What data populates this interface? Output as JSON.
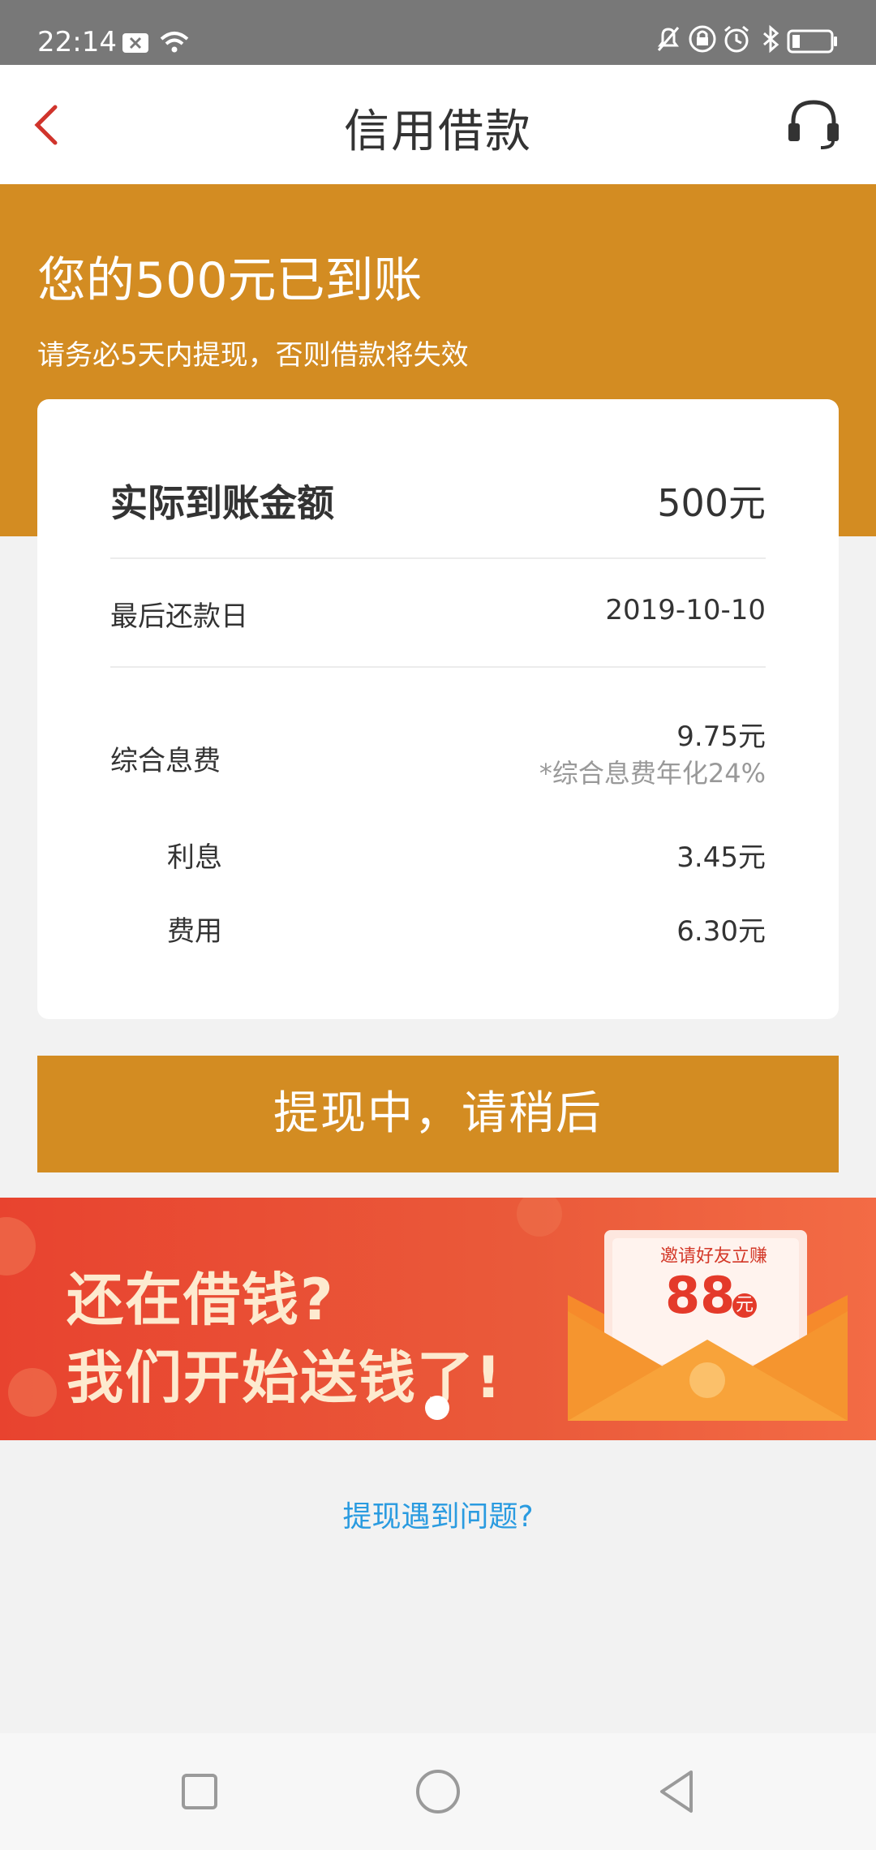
{
  "status_bar": {
    "time": "22:14",
    "icons": [
      "x-badge-icon",
      "wifi-icon",
      "bell-off-icon",
      "lock-icon",
      "alarm-icon",
      "bluetooth-icon",
      "battery-icon"
    ]
  },
  "header": {
    "title": "信用借款",
    "back_icon": "back-chevron-icon",
    "support_icon": "headset-icon"
  },
  "banner": {
    "headline": "您的500元已到账",
    "subtitle": "请务必5天内提现，否则借款将失效"
  },
  "card": {
    "amount_label": "实际到账金额",
    "amount_value": "500元",
    "due_label": "最后还款日",
    "due_value": "2019-10-10",
    "fee_label": "综合息费",
    "fee_value": "9.75元",
    "fee_note": "*综合息费年化24%",
    "interest_label": "利息",
    "interest_value": "3.45元",
    "cost_label": "费用",
    "cost_value": "6.30元"
  },
  "action_button": {
    "label": "提现中，请稍后"
  },
  "promo": {
    "line1": "还在借钱?",
    "line2": "我们开始送钱了!",
    "envelope_caption": "邀请好友立赚",
    "envelope_amount": "88",
    "envelope_unit": "元",
    "carousel_pages": 1,
    "carousel_active": 1
  },
  "help_link": {
    "label": "提现遇到问题?"
  },
  "colors": {
    "accent": "#d38c22",
    "link": "#2a9be0",
    "back_icon": "#d0342c",
    "promo_bg": "#e64a36"
  }
}
